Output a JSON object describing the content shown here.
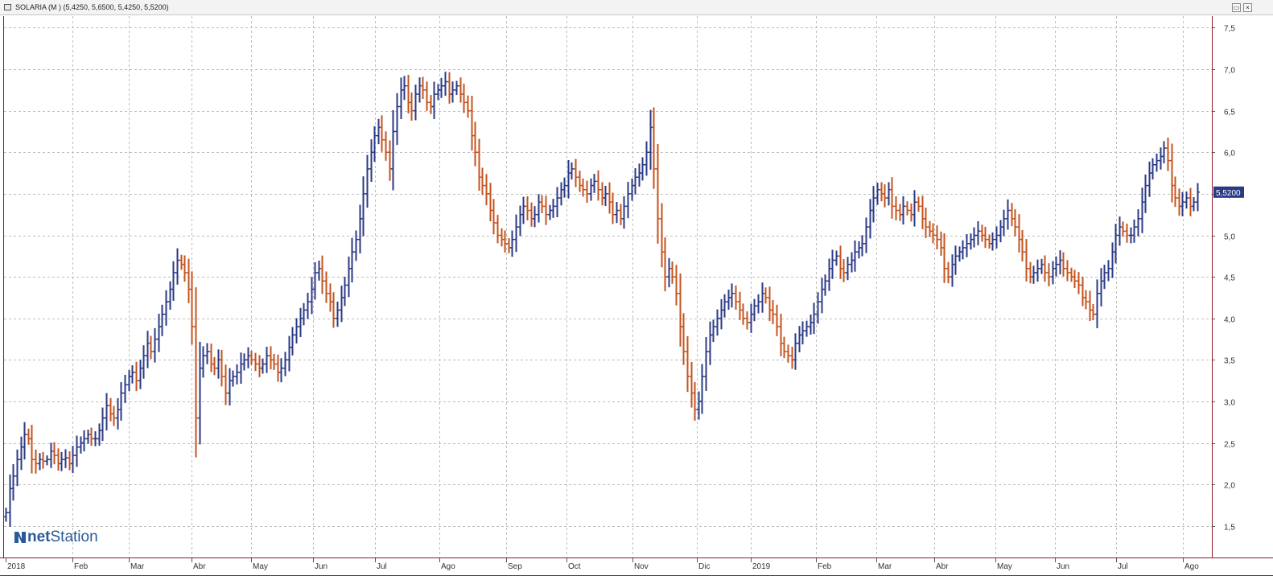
{
  "window": {
    "title": "SOLARIA (M ) (5,4250, 5,6500, 5,4250, 5,5200)"
  },
  "logo": {
    "text_bold": "net",
    "text_regular": "Station",
    "icon": "netstation-logo-icon"
  },
  "colors": {
    "up": "#2b3a85",
    "down": "#c4531e",
    "grid": "#bdbdbd",
    "frame": "#8b1a2a",
    "tag": "#2b3a85"
  },
  "chart_data": {
    "type": "ohlc",
    "ylim": [
      1.12,
      7.64
    ],
    "y_ticks": [
      "7,5",
      "7,0",
      "6,5",
      "6,0",
      "5,5",
      "5,0",
      "4,5",
      "4,0",
      "3,5",
      "3,0",
      "2,5",
      "2,0",
      "1,5"
    ],
    "y_tick_values": [
      7.5,
      7.0,
      6.5,
      6.0,
      5.5,
      5.0,
      4.5,
      4.0,
      3.5,
      3.0,
      2.5,
      2.0,
      1.5
    ],
    "x_labels": [
      "2018",
      "Feb",
      "Mar",
      "Abr",
      "May",
      "Jun",
      "Jul",
      "Ago",
      "Sep",
      "Oct",
      "Nov",
      "Dic",
      "2019",
      "Feb",
      "Mar",
      "Abr",
      "May",
      "Jun",
      "Jul",
      "Ago"
    ],
    "last_price_label": "5,5200",
    "last_price": 5.52,
    "series": [
      {
        "month": "2018-01",
        "close": [
          1.66,
          1.95,
          2.1,
          2.3,
          2.45,
          2.6,
          2.55,
          2.3,
          2.25,
          2.3,
          2.28,
          2.3,
          2.4,
          2.35,
          2.25,
          2.3,
          2.32,
          2.25,
          2.35,
          2.45,
          2.5,
          2.55
        ]
      },
      {
        "month": "2018-02",
        "close": [
          2.6,
          2.55,
          2.55,
          2.65,
          2.8,
          2.95,
          2.85,
          2.8,
          2.9,
          3.1,
          3.2,
          3.3,
          3.35,
          3.25,
          3.4,
          3.55,
          3.7,
          3.6,
          3.75
        ]
      },
      {
        "month": "2018-03",
        "close": [
          3.9,
          4.05,
          4.2,
          4.35,
          4.55,
          4.7,
          4.65,
          4.55,
          4.35,
          3.9,
          2.8,
          3.4,
          3.55,
          3.6,
          3.45,
          3.4,
          3.5,
          3.3,
          3.1,
          3.25
        ]
      },
      {
        "month": "2018-04",
        "close": [
          3.3,
          3.35,
          3.45,
          3.5,
          3.55,
          3.5,
          3.45,
          3.4,
          3.45,
          3.55,
          3.5,
          3.45,
          3.35,
          3.4,
          3.5,
          3.65,
          3.8,
          3.9,
          4.0,
          4.1
        ]
      },
      {
        "month": "2018-05",
        "close": [
          4.2,
          4.35,
          4.55,
          4.6,
          4.45,
          4.3,
          4.2,
          4.0,
          4.1,
          4.25,
          4.4,
          4.6,
          4.8,
          4.95,
          5.2,
          5.5,
          5.8,
          6.0,
          6.2,
          6.3,
          6.15,
          6.0,
          5.8
        ]
      },
      {
        "month": "2018-06",
        "close": [
          6.25,
          6.55,
          6.75,
          6.8,
          6.6,
          6.5,
          6.7,
          6.8,
          6.75,
          6.6,
          6.55,
          6.7,
          6.75,
          6.8,
          6.85,
          6.7,
          6.75,
          6.8,
          6.7,
          6.6,
          6.5
        ]
      },
      {
        "month": "2018-07",
        "close": [
          6.2,
          6.0,
          5.7,
          5.6,
          5.5,
          5.3,
          5.15,
          5.0,
          4.95,
          4.9,
          4.85,
          4.95,
          5.1,
          5.25,
          5.35,
          5.3,
          5.2,
          5.25,
          5.4,
          5.35,
          5.25,
          5.3
        ]
      },
      {
        "month": "2018-08",
        "close": [
          5.35,
          5.45,
          5.55,
          5.6,
          5.75,
          5.8,
          5.7,
          5.6,
          5.55,
          5.5,
          5.6,
          5.65,
          5.55,
          5.45,
          5.5,
          5.4,
          5.25,
          5.3,
          5.2,
          5.35,
          5.5,
          5.6,
          5.7
        ]
      },
      {
        "month": "2018-09",
        "close": [
          5.75,
          5.85,
          6.0,
          6.3,
          5.8,
          5.2,
          4.8,
          4.5,
          4.6,
          4.5,
          4.3,
          3.9,
          3.6,
          3.3,
          3.1,
          2.9,
          3.0,
          3.3,
          3.6,
          3.8,
          3.9
        ]
      },
      {
        "month": "2018-10",
        "close": [
          4.0,
          4.1,
          4.2,
          4.25,
          4.3,
          4.2,
          4.1,
          4.0,
          3.95,
          4.05,
          4.15,
          4.2,
          4.3,
          4.25,
          4.1,
          4.05,
          3.9,
          3.7,
          3.6,
          3.55,
          3.5,
          3.7,
          3.8
        ]
      },
      {
        "month": "2018-11",
        "close": [
          3.85,
          3.9,
          3.95,
          4.05,
          4.2,
          4.35,
          4.45,
          4.6,
          4.7,
          4.75,
          4.6,
          4.55,
          4.65,
          4.7,
          4.8,
          4.85,
          4.9,
          5.1,
          5.3,
          5.45,
          5.55
        ]
      },
      {
        "month": "2018-12",
        "close": [
          5.5,
          5.45,
          5.55,
          5.35,
          5.3,
          5.25,
          5.35,
          5.3,
          5.25,
          5.4,
          5.35,
          5.2,
          5.1,
          5.05,
          5.0,
          4.95,
          4.85,
          4.6,
          4.5,
          4.65,
          4.75,
          4.8
        ]
      },
      {
        "month": "2019-01",
        "close": [
          4.85,
          4.9,
          4.95,
          5.0,
          5.05,
          5.0,
          4.95,
          4.9,
          4.95,
          5.0,
          5.1,
          5.2,
          5.3,
          5.2,
          5.1,
          4.95,
          4.8,
          4.6,
          4.5,
          4.55
        ]
      },
      {
        "month": "2019-02",
        "close": [
          4.6,
          4.65,
          4.55,
          4.5,
          4.6,
          4.65,
          4.7,
          4.6,
          4.55,
          4.5,
          4.45,
          4.4,
          4.25,
          4.2,
          4.1,
          4.05,
          4.3,
          4.45,
          4.55,
          4.6
        ]
      },
      {
        "month": "2019-03",
        "close": [
          4.8,
          5.0,
          5.1,
          5.05,
          5.0,
          5.0,
          5.1,
          5.2,
          5.4,
          5.6,
          5.75,
          5.85,
          5.9,
          5.95,
          6.05,
          5.9,
          5.6,
          5.45,
          5.35,
          5.4,
          5.45,
          5.35,
          5.4,
          5.52
        ]
      }
    ]
  }
}
